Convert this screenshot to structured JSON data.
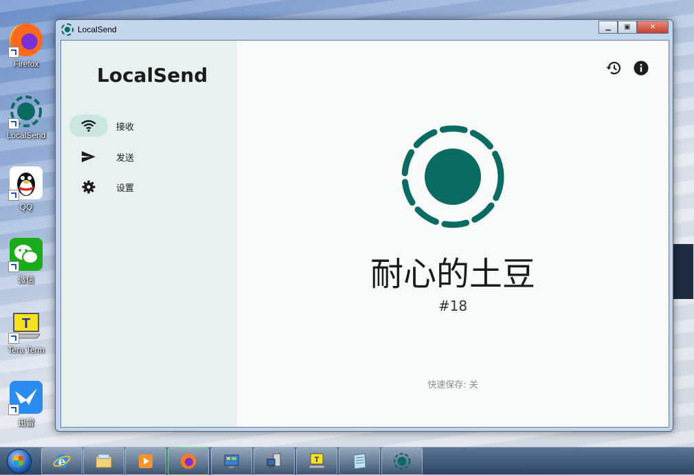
{
  "desktop": {
    "icons": [
      {
        "label": "Firefox",
        "icon": "firefox-icon"
      },
      {
        "label": "LocalSend",
        "icon": "localsend-icon"
      },
      {
        "label": "QQ",
        "icon": "qq-icon"
      },
      {
        "label": "微信",
        "icon": "wechat-icon"
      },
      {
        "label": "Tera Term",
        "icon": "teraterm-icon"
      },
      {
        "label": "迅雷",
        "icon": "xunlei-icon"
      }
    ]
  },
  "window": {
    "title": "LocalSend",
    "buttons": [
      "minimize",
      "maximize",
      "close"
    ]
  },
  "sidebar": {
    "brand": "LocalSend",
    "items": [
      {
        "label": "接收",
        "icon": "wifi-icon",
        "active": true
      },
      {
        "label": "发送",
        "icon": "send-icon",
        "active": false
      },
      {
        "label": "设置",
        "icon": "gear-icon",
        "active": false
      }
    ]
  },
  "main": {
    "device_name": "耐心的土豆",
    "device_number": "#18",
    "quick_save": "快速保存: 关",
    "top_icons": [
      "history-icon",
      "info-icon"
    ]
  },
  "taskbar": {
    "items": [
      "internet-explorer-icon",
      "file-explorer-icon",
      "media-player-icon",
      "firefox-icon",
      "control-panel-icon",
      "network-icon",
      "teraterm-icon",
      "notepad-icon",
      "localsend-icon"
    ]
  },
  "colors": {
    "accent": "#0a6b63",
    "sidebar_bg": "#e8f1ef",
    "active_pill": "#c9e6e1"
  }
}
